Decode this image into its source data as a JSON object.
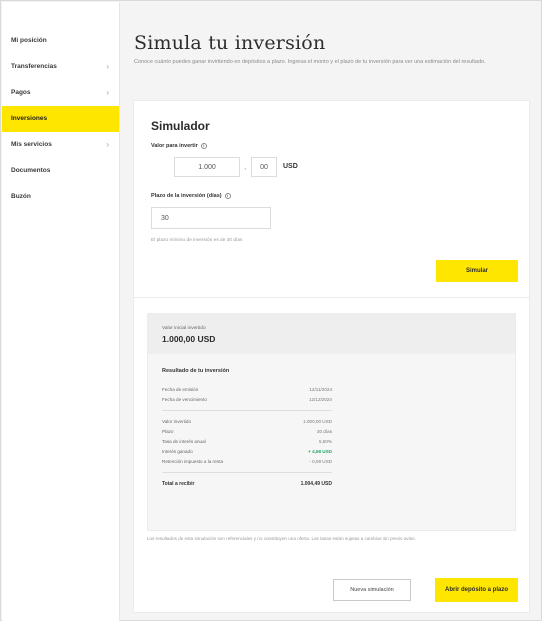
{
  "sidebar": {
    "items": [
      {
        "label": "Mi posición",
        "chevron": false,
        "active": false
      },
      {
        "label": "Transferencias",
        "chevron": true,
        "active": false
      },
      {
        "label": "Pagos",
        "chevron": true,
        "active": false
      },
      {
        "label": "Inversiones",
        "chevron": false,
        "active": true
      },
      {
        "label": "Mis servicios",
        "chevron": true,
        "active": false
      },
      {
        "label": "Documentos",
        "chevron": false,
        "active": false
      },
      {
        "label": "Buzón",
        "chevron": false,
        "active": false
      }
    ],
    "chevron_glyph": "›"
  },
  "header": {
    "title": "Simula tu inversión",
    "subtitle": "Conoce cuánto puedes ganar invirtiendo en depósitos a plazo. Ingresa el monto y el plazo de tu inversión para ver una estimación del resultado."
  },
  "simulator": {
    "title": "Simulador",
    "amount_label": "Valor para invertir",
    "amount_integer": "1.000",
    "amount_sep": ",",
    "amount_decimals": "00",
    "currency": "USD",
    "term_label": "Plazo de la inversión (días)",
    "term_value": "30",
    "hint": "El plazo mínimo de inversión es de 30 días",
    "simulate_button": "Simular"
  },
  "results": {
    "head_label": "Valor inicial invertido",
    "head_value": "1.000,00 USD",
    "section_title": "Resultado de tu inversión",
    "dates": [
      {
        "label": "Fecha de emisión",
        "value": "12/11/2024"
      },
      {
        "label": "Fecha de vencimiento",
        "value": "12/12/2024"
      }
    ],
    "details": [
      {
        "label": "Valor invertido",
        "value": "1.000,00 USD",
        "green": false
      },
      {
        "label": "Plazo",
        "value": "30 días",
        "green": false
      },
      {
        "label": "Tasa de interés anual",
        "value": "5,50%",
        "green": false
      },
      {
        "label": "Interés ganado",
        "value": "+ 4,58 USD",
        "green": true
      },
      {
        "label": "Retención impuesto a la renta",
        "value": "- 0,09 USD",
        "green": false
      }
    ],
    "total_label": "Total a recibir",
    "total_value": "1.004,49 USD"
  },
  "disclaimer": "Los resultados de esta simulación son referenciales y no constituyen una oferta. Las tasas están sujetas a cambios sin previo aviso.",
  "actions": {
    "secondary": "Nueva simulación",
    "primary": "Abrir depósito a plazo"
  },
  "colors": {
    "accent": "#ffe600",
    "positive": "#21a366"
  }
}
